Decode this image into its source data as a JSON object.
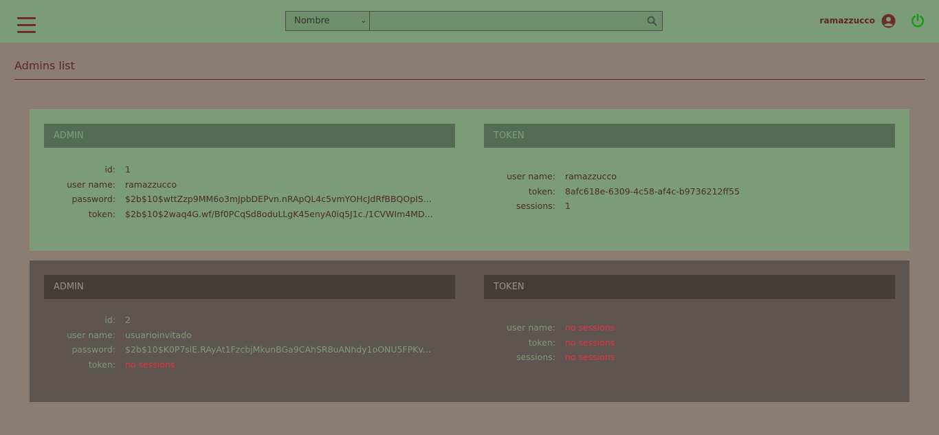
{
  "header": {
    "search_select_value": "Nombre",
    "search_placeholder": "",
    "username": "ramazzucco"
  },
  "page": {
    "title": "Admins list"
  },
  "admins": [
    {
      "admin_heading": "ADMIN",
      "token_heading": "TOKEN",
      "admin": {
        "id_label": "id:",
        "id": "1",
        "user_name_label": "user name:",
        "user_name": "ramazzucco",
        "password_label": "password:",
        "password": "$2b$10$wttZzp9MM6o3mJpbDEPvn.nRApQL4c5vmYOHcJdRfBBQOpIS...",
        "token_label": "token:",
        "token": "$2b$10$2waq4G.wf/Bf0PCqSd8oduLLgK45enyA0iq5J1c./1CVWIm4MD..."
      },
      "token": {
        "user_name_label": "user name:",
        "user_name": "ramazzucco",
        "token_label": "token:",
        "token": "8afc618e-6309-4c58-af4c-b9736212ff55",
        "sessions_label": "sessions:",
        "sessions": "1"
      }
    },
    {
      "admin_heading": "ADMIN",
      "token_heading": "TOKEN",
      "admin": {
        "id_label": "id:",
        "id": "2",
        "user_name_label": "user name:",
        "user_name": "usuarioinvitado",
        "password_label": "password:",
        "password": "$2b$10$K0P7slE.RAyAt1FzcbjMkunBGa9CAhSR8uANhdy1oONU5FPKv...",
        "token_label": "token:",
        "token": "no sessions"
      },
      "token": {
        "user_name_label": "user name:",
        "user_name": "no sessions",
        "token_label": "token:",
        "token": "no sessions",
        "sessions_label": "sessions:",
        "sessions": "no sessions"
      }
    }
  ],
  "colors": {
    "header_bg": "#7c9b78",
    "page_bg": "#8b7d72",
    "accent": "#5f2525",
    "power": "#1a9a1a",
    "warning": "#e0333f"
  },
  "icons": {
    "menu": "hamburger-icon",
    "search": "search-icon",
    "user": "user-circle-icon",
    "logout": "power-icon"
  }
}
